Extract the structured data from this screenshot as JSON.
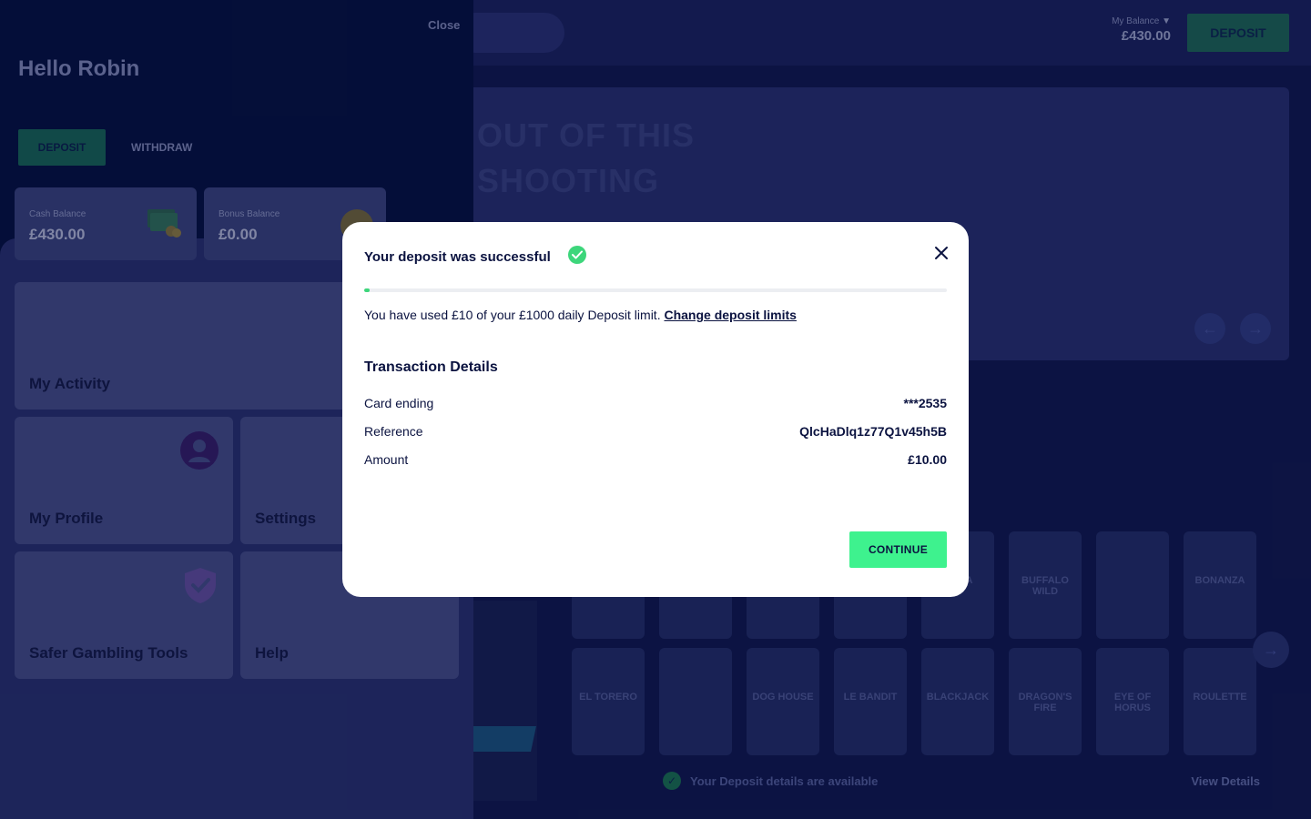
{
  "site": {
    "header": {
      "balance_label": "My Balance",
      "balance_value": "£430.00",
      "deposit_label": "DEPOSIT"
    },
    "hero": {
      "line1": "OUT OF THIS",
      "line2": "SHOOTING"
    },
    "games_top": [
      "",
      "",
      "",
      "",
      "Mega",
      "Buffalo Wild",
      "",
      "Bonanza"
    ],
    "games_bottom": [
      "El Torero",
      "",
      "Dog House",
      "Le Bandit",
      "Blackjack",
      "Dragon's Fire",
      "Eye of Horus",
      "Roulette"
    ],
    "notification": {
      "text": "Your Deposit details are available",
      "link": "View Details"
    }
  },
  "drawer": {
    "close_label": "Close",
    "greeting": "Hello Robin",
    "tabs": {
      "deposit": "DEPOSIT",
      "withdraw": "WITHDRAW"
    },
    "balances": {
      "cash_label": "Cash Balance",
      "cash_value": "£430.00",
      "bonus_label": "Bonus Balance",
      "bonus_value": "£0.00"
    },
    "menu": {
      "activity": "My Activity",
      "profile": "My Profile",
      "settings": "Settings",
      "safer": "Safer Gambling Tools",
      "help": "Help"
    }
  },
  "modal": {
    "title": "Your deposit was successful",
    "limit_prefix": "You have used £10 of your £1000 daily Deposit limit.",
    "limit_link": "Change deposit limits",
    "limit_used": 10,
    "limit_total": 1000,
    "details_heading": "Transaction Details",
    "rows": [
      {
        "label": "Card ending",
        "value": "***2535"
      },
      {
        "label": "Reference",
        "value": "QlcHaDlq1z77Q1v45h5B"
      },
      {
        "label": "Amount",
        "value": "£10.00"
      }
    ],
    "continue_label": "CONTINUE"
  },
  "colors": {
    "accent_green": "#3ef28e",
    "success_green": "#3dd67b",
    "navy": "#0b1340"
  },
  "icons": [
    "success-check-icon",
    "close-icon",
    "cash-icon",
    "coin-icon",
    "profile-icon",
    "shield-check-icon",
    "chevron-down-icon",
    "arrow-left-icon",
    "arrow-right-icon"
  ]
}
